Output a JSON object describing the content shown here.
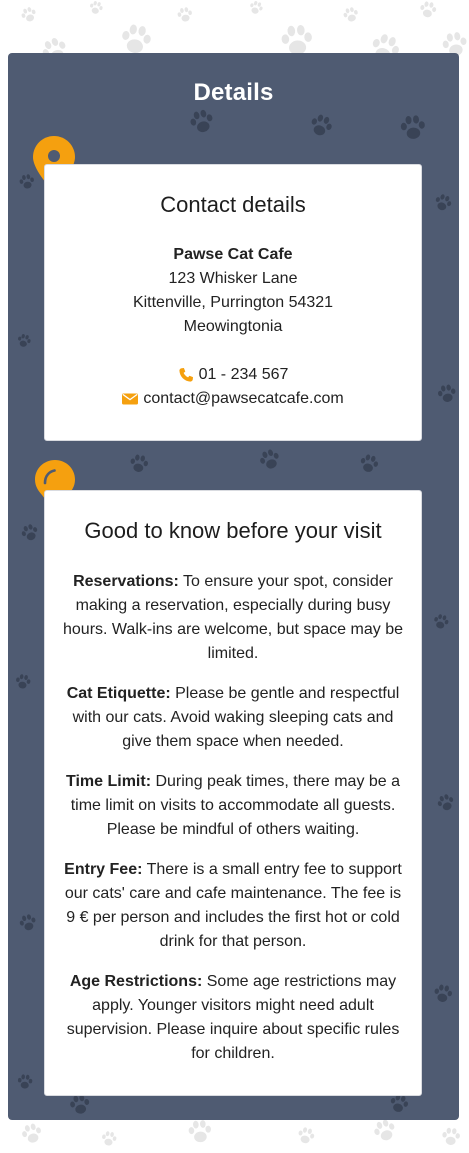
{
  "section": {
    "title": "Details"
  },
  "contact": {
    "heading": "Contact details",
    "business_name": "Pawse Cat Cafe",
    "street": "123 Whisker Lane",
    "city_line": "Kittenville, Purrington 54321",
    "country": "Meowingtonia",
    "phone": "01 - 234 567",
    "email": "contact@pawsecatcafe.com"
  },
  "info": {
    "heading": "Good to know before your visit",
    "items": [
      {
        "label": "Reservations:",
        "text": " To ensure your spot, consider making a reservation, especially during busy hours. Walk-ins are welcome, but space may be limited."
      },
      {
        "label": "Cat Etiquette:",
        "text": " Please be gentle and respectful with our cats. Avoid waking sleeping cats and give them space when needed."
      },
      {
        "label": "Time Limit:",
        "text": " During peak times, there may be a time limit on visits to accommodate all guests. Please be mindful of others waiting."
      },
      {
        "label": "Entry Fee:",
        "text": " There is a small entry fee to support our cats' care and cafe maintenance. The fee is 9 € per person and includes the first hot or cold drink for that person."
      },
      {
        "label": "Age Restrictions:",
        "text": " Some age restrictions may apply. Younger visitors might need adult supervision. Please inquire about specific rules for children."
      }
    ]
  },
  "colors": {
    "accent": "#f5a00f",
    "panel_bg": "#4f5b72",
    "card_bg": "#ffffff"
  },
  "icons": {
    "location": "map-marker-icon",
    "tips": "lightbulb-icon",
    "phone": "phone-icon",
    "email": "envelope-icon",
    "background": "paw-print-icon"
  }
}
